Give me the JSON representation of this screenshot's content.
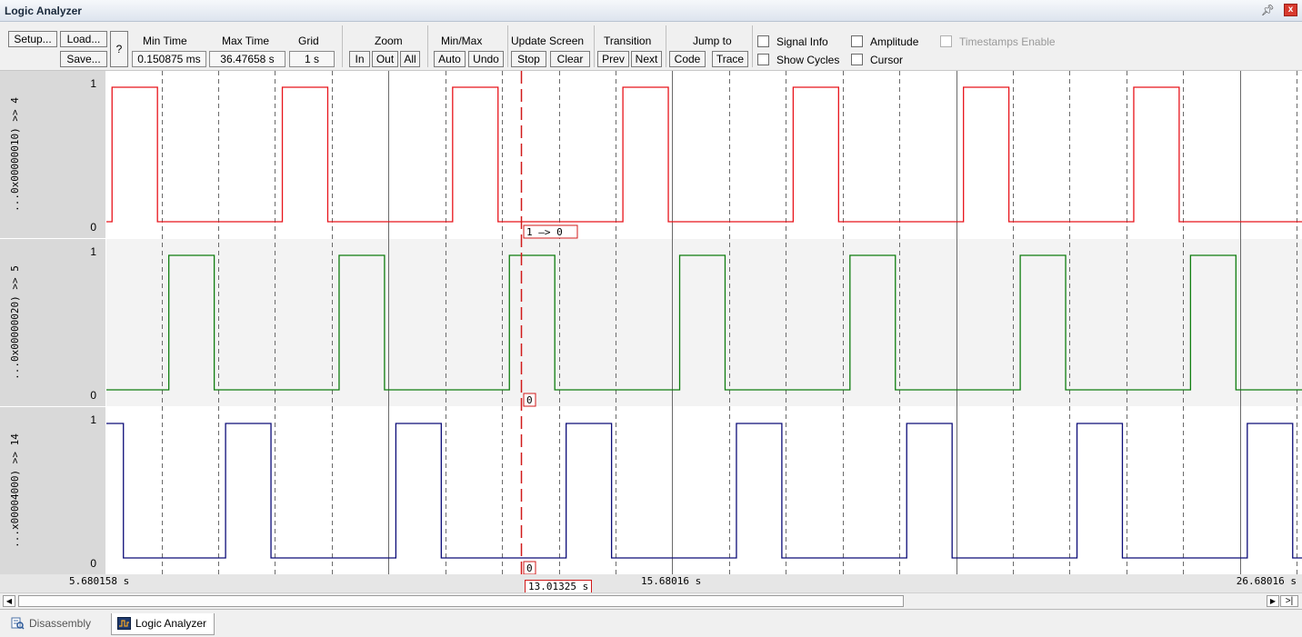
{
  "window": {
    "title": "Logic Analyzer"
  },
  "toolbar": {
    "setup": "Setup...",
    "load": "Load...",
    "save": "Save...",
    "help": "?",
    "min_time_label": "Min Time",
    "min_time_value": "0.150875 ms",
    "max_time_label": "Max Time",
    "max_time_value": "36.47658 s",
    "grid_label": "Grid",
    "grid_value": "1 s",
    "zoom_label": "Zoom",
    "zoom_in": "In",
    "zoom_out": "Out",
    "zoom_all": "All",
    "minmax_label": "Min/Max",
    "auto": "Auto",
    "undo": "Undo",
    "update_label": "Update Screen",
    "stop": "Stop",
    "clear": "Clear",
    "transition_label": "Transition",
    "prev": "Prev",
    "next": "Next",
    "jump_label": "Jump to",
    "code": "Code",
    "trace": "Trace",
    "signal_info": "Signal Info",
    "amplitude": "Amplitude",
    "timestamps": "Timestamps Enable",
    "show_cycles": "Show Cycles",
    "cursor": "Cursor"
  },
  "signals": [
    {
      "name": "...0x00000010) >> 4",
      "max": "1",
      "min": "0",
      "color": "#e8141b",
      "edges": [
        0.1,
        0.9,
        3.1,
        3.9,
        6.1,
        6.9,
        9.1,
        9.9,
        12.1,
        12.9,
        15.1,
        15.9,
        18.1,
        18.9
      ],
      "start_level": 0,
      "annotation": "1 —> 0"
    },
    {
      "name": "...0x00000020) >> 5",
      "max": "1",
      "min": "0",
      "color": "#0f7d0f",
      "edges": [
        1.1,
        1.9,
        4.1,
        4.9,
        7.1,
        7.9,
        10.1,
        10.9,
        13.1,
        13.9,
        16.1,
        16.9,
        19.1,
        19.9
      ],
      "start_level": 0,
      "annotation": "0"
    },
    {
      "name": "...x00004000) >> 14",
      "max": "1",
      "min": "0",
      "color": "#0c0c78",
      "edges": [
        0.3,
        2.1,
        2.9,
        5.1,
        5.9,
        8.1,
        8.9,
        11.1,
        11.9,
        14.1,
        14.9,
        17.1,
        17.9,
        20.1,
        20.9
      ],
      "start_level": 1,
      "annotation": "0"
    }
  ],
  "time_axis": {
    "left_label": "5.680158 s",
    "cursor_label": "13.01325 s",
    "mid_label": "15.68016 s",
    "right_label": "26.68016 s"
  },
  "tabs": [
    {
      "label": "Disassembly",
      "active": false
    },
    {
      "label": "Logic Analyzer",
      "active": true
    }
  ],
  "colors": {
    "cursor": "#d11a1a",
    "grid": "#6a6a6a",
    "label_bg": "#d9d9d9"
  }
}
